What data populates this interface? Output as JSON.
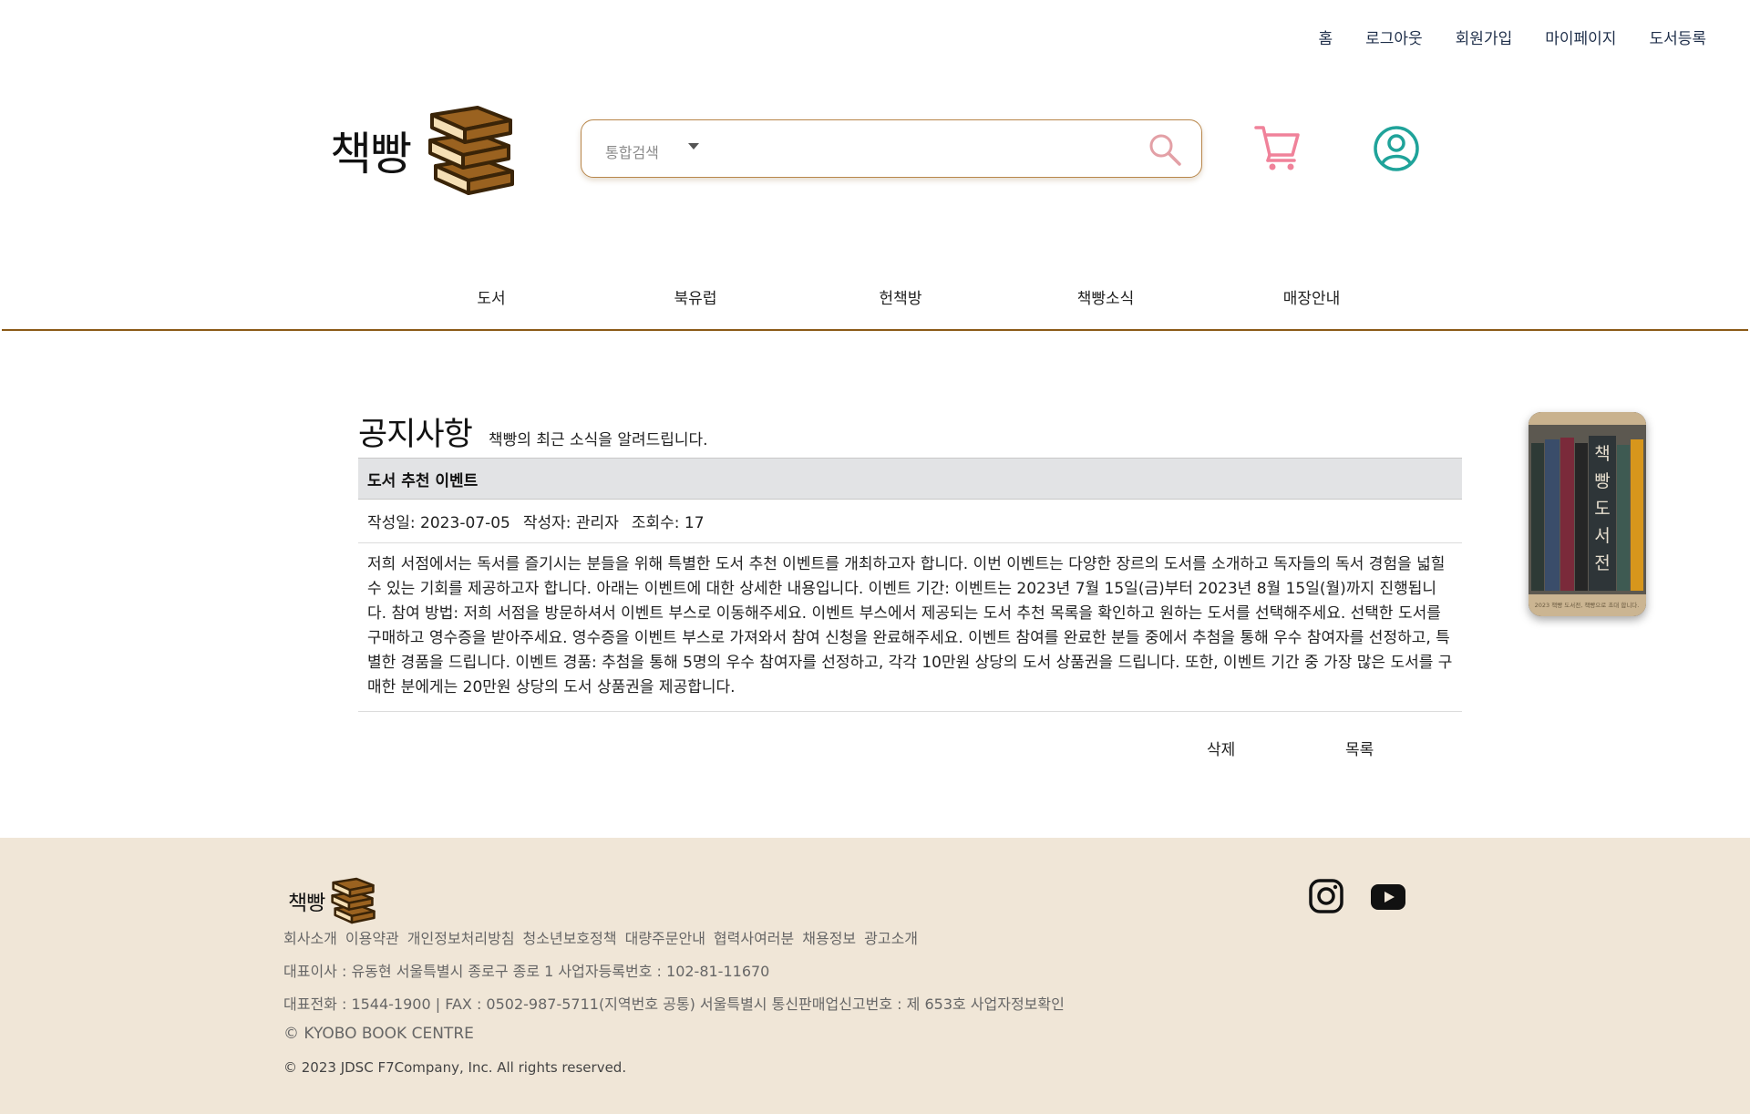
{
  "top_links": [
    "홈",
    "로그아웃",
    "회원가입",
    "마이페이지",
    "도서등록"
  ],
  "logo": {
    "text": "책빵"
  },
  "search": {
    "category": "통합검색",
    "placeholder": "",
    "value": ""
  },
  "icons": {
    "search": "search-icon",
    "cart": "cart-icon",
    "user": "user-icon",
    "instagram": "instagram-icon",
    "youtube": "youtube-icon"
  },
  "nav": [
    "도서",
    "북유럽",
    "헌책방",
    "책빵소식",
    "매장안내"
  ],
  "notice": {
    "title": "공지사항",
    "subtitle": "책빵의 최근 소식을 알려드립니다.",
    "post_title": "도서 추천 이벤트",
    "date": "작성일: 2023-07-05",
    "author": "작성자: 관리자",
    "views": "조회수: 17",
    "body": "저희 서점에서는 독서를 즐기시는 분들을 위해 특별한 도서 추천 이벤트를 개최하고자 합니다. 이번 이벤트는 다양한 장르의 도서를 소개하고 독자들의 독서 경험을 넓힐 수 있는 기회를 제공하고자 합니다. 아래는 이벤트에 대한 상세한 내용입니다. 이벤트 기간: 이벤트는 2023년 7월 15일(금)부터 2023년 8월 15일(월)까지 진행됩니다. 참여 방법: 저희 서점을 방문하셔서 이벤트 부스로 이동해주세요. 이벤트 부스에서 제공되는 도서 추천 목록을 확인하고 원하는 도서를 선택해주세요. 선택한 도서를 구매하고 영수증을 받아주세요. 영수증을 이벤트 부스로 가져와서 참여 신청을 완료해주세요. 이벤트 참여를 완료한 분들 중에서 추첨을 통해 우수 참여자를 선정하고, 특별한 경품을 드립니다. 이벤트 경품: 추첨을 통해 5명의 우수 참여자를 선정하고, 각각 10만원 상당의 도서 상품권을 드립니다. 또한, 이벤트 기간 중 가장 많은 도서를 구매한 분에게는 20만원 상당의 도서 상품권을 제공합니다.",
    "delete_label": "삭제",
    "list_label": "목록"
  },
  "banner": {
    "title": "책빵도서전",
    "caption": "2023 책빵 도서전, 책빵으로 초대 합니다."
  },
  "footer": {
    "logo_text": "책빵",
    "links": [
      "회사소개",
      "이용약관",
      "개인정보처리방침",
      "청소년보호정책",
      "대량주문안내",
      "협력사여러분",
      "채용정보",
      "광고소개"
    ],
    "line1": "대표이사 : 유동현 서울특별시 종로구 종로 1 사업자등록번호 : 102-81-11670",
    "line2": "대표전화 : 1544-1900 | FAX : 0502-987-5711(지역번호 공통) 서울특별시 통신판매업신고번호 : 제 653호 사업자정보확인",
    "line3": "© KYOBO BOOK CENTRE",
    "copyright": "© 2023 JDSC F7Company, Inc. All rights reserved."
  },
  "colors": {
    "nav_line": "#8b5a18",
    "footer_bg": "#f0e6d7",
    "cart": "#f0829a",
    "user": "#1fa39a",
    "search_border": "#b8864a"
  }
}
